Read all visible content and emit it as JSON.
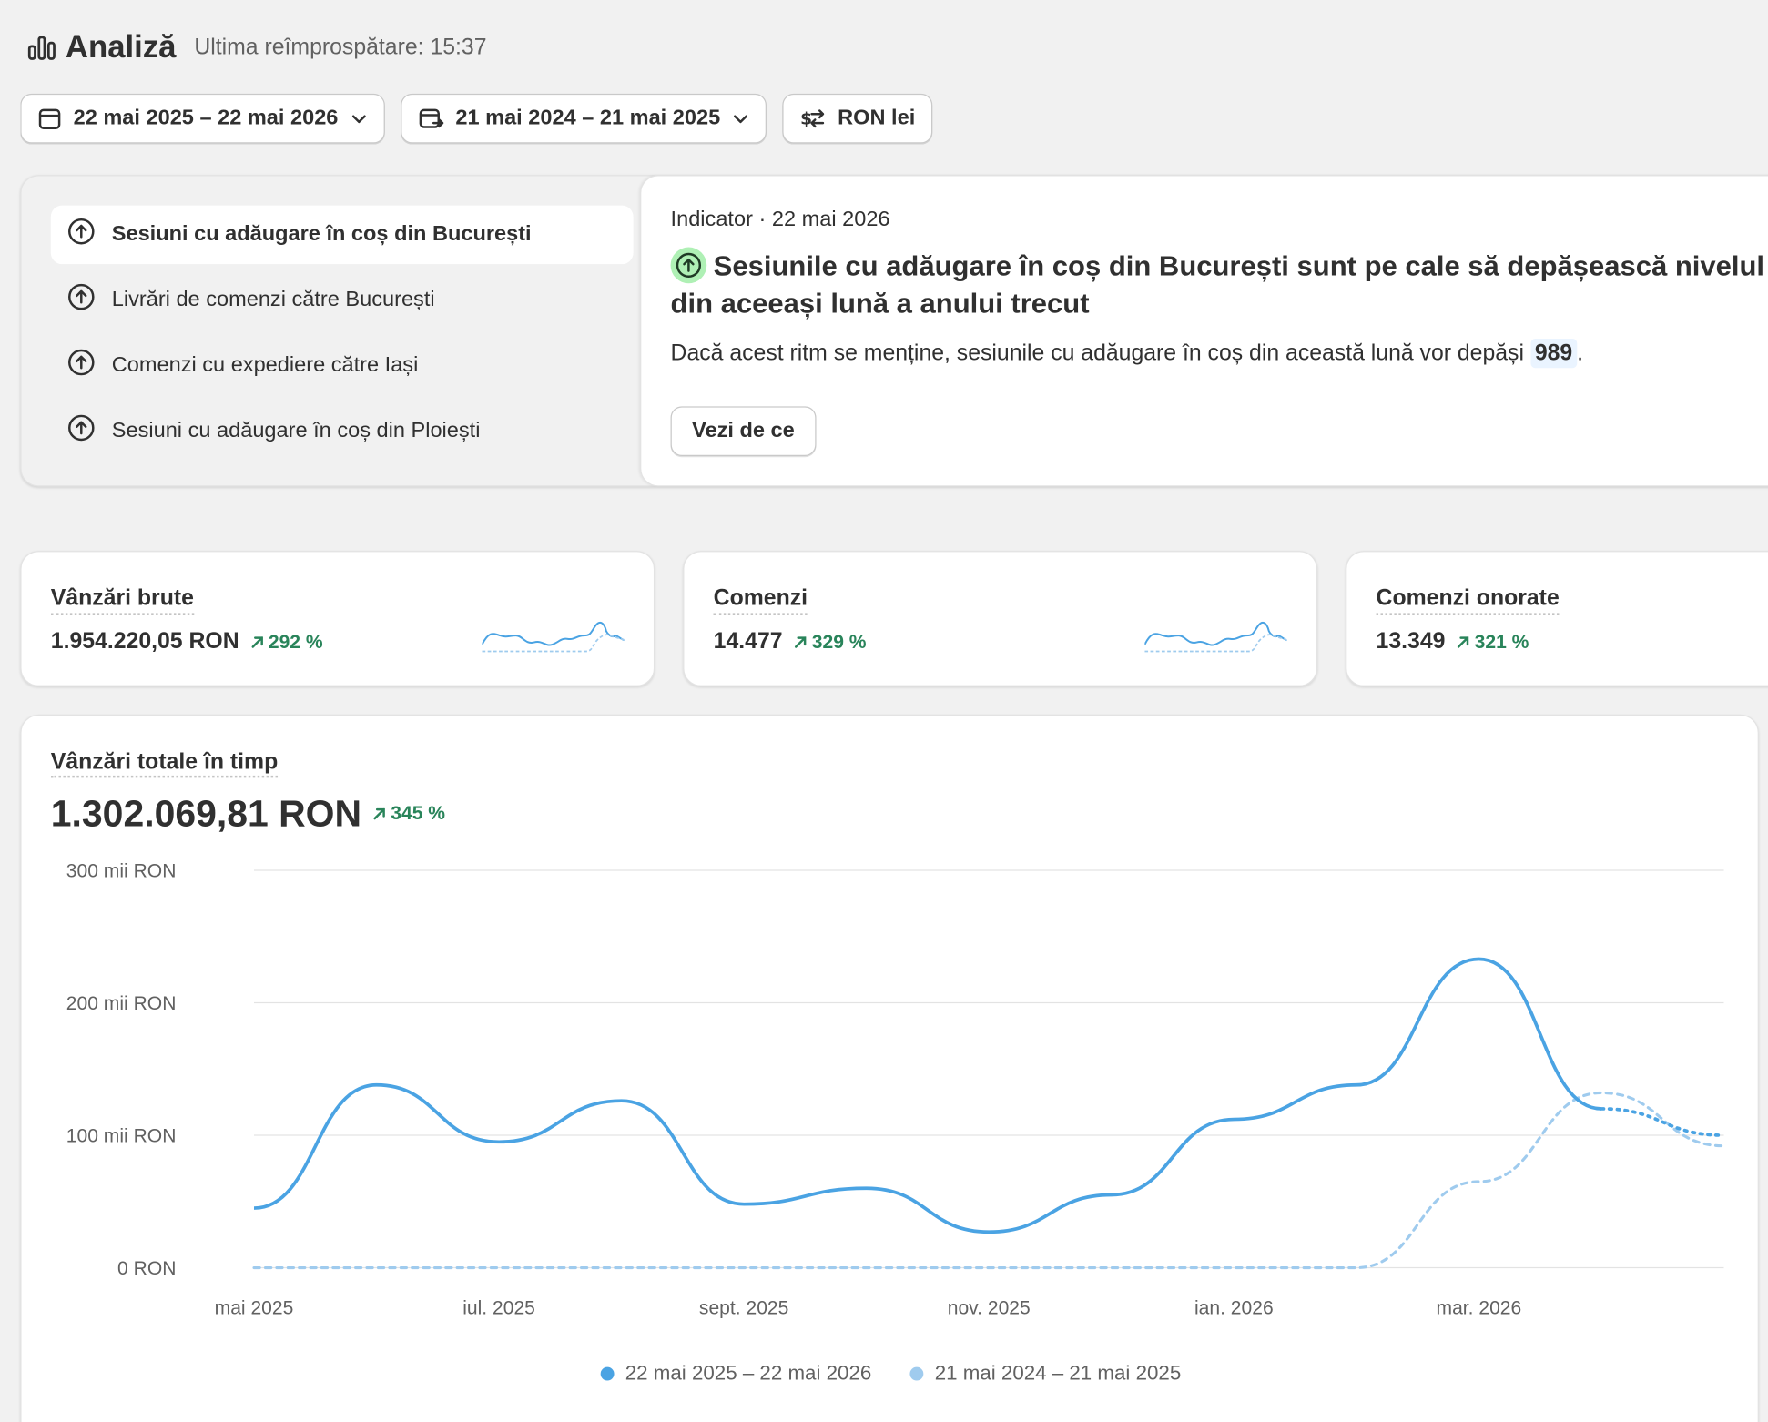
{
  "header": {
    "title": "Analiză",
    "last_refresh": "Ultima reîmprospătare: 15:37"
  },
  "filters": {
    "date_range": "22 mai 2025 – 22 mai 2026",
    "compare_range": "21 mai 2024 – 21 mai 2025",
    "currency": "RON lei"
  },
  "insights": {
    "items": [
      {
        "label": "Sesiuni cu adăugare în coș din București",
        "active": true
      },
      {
        "label": "Livrări de comenzi către București",
        "active": false
      },
      {
        "label": "Comenzi cu expediere către Iași",
        "active": false
      },
      {
        "label": "Sesiuni cu adăugare în coș din Ploiești",
        "active": false
      }
    ],
    "panel": {
      "meta": "Indicator · 22 mai 2026",
      "headline_line1": "Sesiunile cu adăugare în coș din București sunt pe cale să depășească nivelul",
      "headline_line2": "din aceeași lună a anului trecut",
      "body_prefix": "Dacă acest ritm se menține, sesiunile cu adăugare în coș din această lună vor depăși",
      "body_value": "989",
      "body_suffix": ".",
      "button": "Vezi de ce"
    }
  },
  "metrics": [
    {
      "title": "Vânzări brute",
      "value": "1.954.220,05 RON",
      "delta": "292 %"
    },
    {
      "title": "Comenzi",
      "value": "14.477",
      "delta": "329 %"
    },
    {
      "title": "Comenzi onorate",
      "value": "13.349",
      "delta": "321 %"
    }
  ],
  "sales_chart": {
    "title": "Vânzări totale în timp",
    "total": "1.302.069,81 RON",
    "delta": "345 %"
  },
  "colors": {
    "current": "#4aa3e3",
    "previous": "#9fcbee",
    "positive": "#29845a"
  },
  "chart_data": {
    "type": "line",
    "title": "Vânzări totale în timp",
    "ylabel": "",
    "xlabel": "",
    "y_unit": "mii RON",
    "ylim": [
      0,
      300
    ],
    "y_ticks": [
      "0 RON",
      "100 mii RON",
      "200 mii RON",
      "300 mii RON"
    ],
    "y_tick_values": [
      0,
      100,
      200,
      300
    ],
    "x_ticks": [
      "mai 2025",
      "iul. 2025",
      "sept. 2025",
      "nov. 2025",
      "ian. 2026",
      "mar. 2026"
    ],
    "grid": true,
    "legend_position": "bottom",
    "series": [
      {
        "name": "22 mai 2025 – 22 mai 2026",
        "x": [
          "2025-05-01",
          "2025-06-01",
          "2025-07-01",
          "2025-08-01",
          "2025-09-01",
          "2025-10-01",
          "2025-11-01",
          "2025-12-01",
          "2026-01-01",
          "2026-02-01",
          "2026-03-01",
          "2026-04-01",
          "2026-05-01"
        ],
        "values": [
          45,
          138,
          95,
          126,
          48,
          60,
          27,
          55,
          112,
          138,
          233,
          120,
          100
        ],
        "partial_last": true
      },
      {
        "name": "21 mai 2024 – 21 mai 2025",
        "x": [
          "2025-05-01",
          "2025-06-01",
          "2025-07-01",
          "2025-08-01",
          "2025-09-01",
          "2025-10-01",
          "2025-11-01",
          "2025-12-01",
          "2026-01-01",
          "2026-02-01",
          "2026-03-01",
          "2026-04-01",
          "2026-05-01"
        ],
        "values": [
          0,
          0,
          0,
          0,
          0,
          0,
          0,
          0,
          0,
          0,
          65,
          132,
          92
        ]
      }
    ]
  }
}
